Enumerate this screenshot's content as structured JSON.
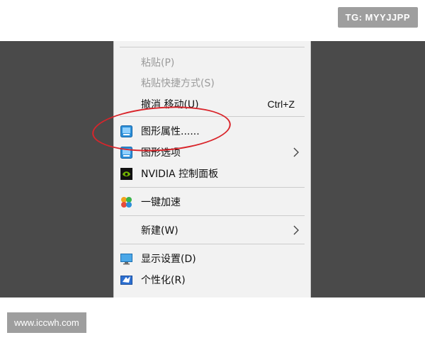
{
  "watermarks": {
    "top_right": "TG: MYYJJPP",
    "bottom_left": "www.iccwh.com"
  },
  "context_menu": {
    "items": [
      {
        "label": "粘贴(P)",
        "state": "disabled"
      },
      {
        "label": "粘贴快捷方式(S)",
        "state": "disabled"
      },
      {
        "label": "撤消 移动(U)",
        "shortcut": "Ctrl+Z"
      },
      {
        "label": "图形属性......",
        "icon": "intel-graphics-icon",
        "highlighted": true
      },
      {
        "label": "图形选项",
        "icon": "intel-graphics-icon",
        "has_submenu": true
      },
      {
        "label": "NVIDIA 控制面板",
        "icon": "nvidia-icon"
      },
      {
        "label": "一键加速",
        "icon": "speedup-icon"
      },
      {
        "label": "新建(W)",
        "has_submenu": true
      },
      {
        "label": "显示设置(D)",
        "icon": "display-icon"
      },
      {
        "label": "个性化(R)",
        "icon": "personalize-icon"
      }
    ]
  },
  "colors": {
    "desktop": "#4a4a4a",
    "menu_bg": "#f2f2f2",
    "annotation": "#d9252b"
  }
}
